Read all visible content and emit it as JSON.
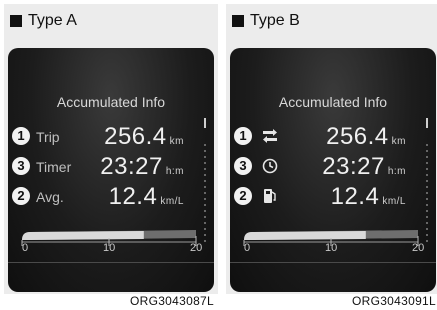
{
  "panels": [
    {
      "header": "Type A",
      "title": "Accumulated Info",
      "rows": [
        {
          "badge": "1",
          "label": "Trip",
          "value": "256.4",
          "unit": "km"
        },
        {
          "badge": "3",
          "label": "Timer",
          "value": "23:27",
          "unit": "h:m"
        },
        {
          "badge": "2",
          "label": "Avg.",
          "value": "12.4",
          "unit": "km/L"
        }
      ],
      "scale": [
        "0",
        "10",
        "20"
      ],
      "code": "ORG3043087L"
    },
    {
      "header": "Type B",
      "title": "Accumulated Info",
      "rows": [
        {
          "badge": "1",
          "icon": "route-icon",
          "value": "256.4",
          "unit": "km"
        },
        {
          "badge": "3",
          "icon": "clock-icon",
          "value": "23:27",
          "unit": "h:m"
        },
        {
          "badge": "2",
          "icon": "fuel-pump-icon",
          "value": "12.4",
          "unit": "km/L"
        }
      ],
      "scale": [
        "0",
        "10",
        "20"
      ],
      "code": "ORG3043091L"
    }
  ],
  "gauge_fill": 0.7
}
